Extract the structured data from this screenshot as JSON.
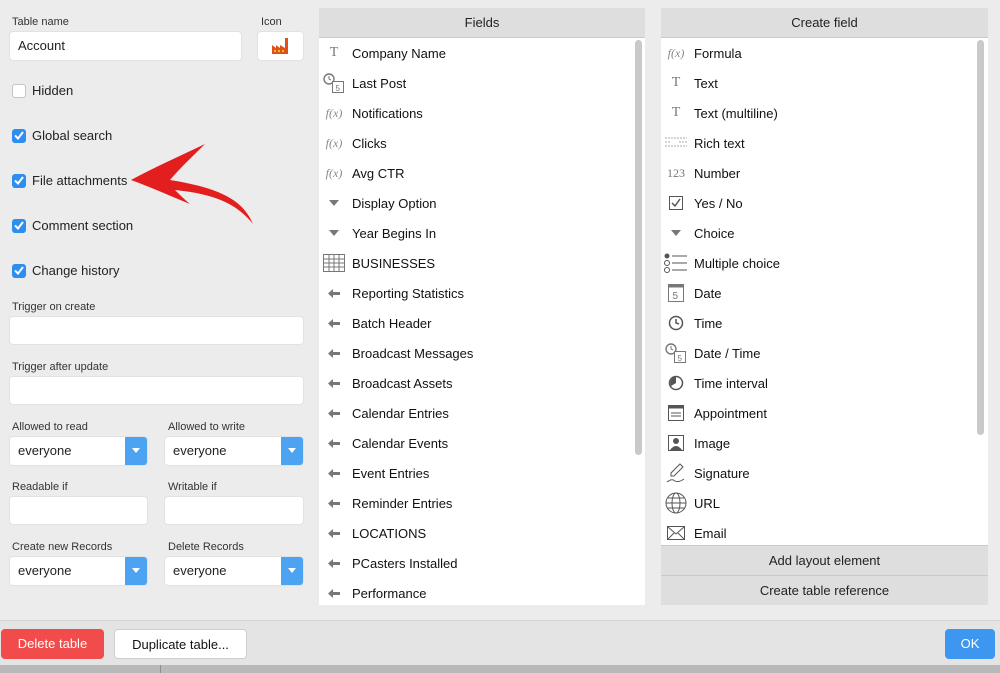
{
  "left": {
    "table_name_label": "Table name",
    "table_name_value": "Account",
    "icon_label": "Icon",
    "icon_name": "factory-icon",
    "options": [
      {
        "label": "Hidden",
        "checked": false
      },
      {
        "label": "Global search",
        "checked": true
      },
      {
        "label": "File attachments",
        "checked": true
      },
      {
        "label": "Comment section",
        "checked": true
      },
      {
        "label": "Change history",
        "checked": true
      }
    ],
    "trigger_create_label": "Trigger on create",
    "trigger_create_value": "",
    "trigger_update_label": "Trigger after update",
    "trigger_update_value": "",
    "allowed_read_label": "Allowed to read",
    "allowed_read_value": "everyone",
    "allowed_write_label": "Allowed to write",
    "allowed_write_value": "everyone",
    "readable_if_label": "Readable if",
    "readable_if_value": "",
    "writable_if_label": "Writable if",
    "writable_if_value": "",
    "create_records_label": "Create new Records",
    "create_records_value": "everyone",
    "delete_records_label": "Delete Records",
    "delete_records_value": "everyone",
    "annotation_color": "#e31e1e"
  },
  "fields": {
    "title": "Fields",
    "items": [
      {
        "label": "Company Name",
        "icon": "text-icon"
      },
      {
        "label": "Last Post",
        "icon": "datetime-icon"
      },
      {
        "label": "Notifications",
        "icon": "formula-icon"
      },
      {
        "label": "Clicks",
        "icon": "formula-icon"
      },
      {
        "label": "Avg CTR",
        "icon": "formula-icon"
      },
      {
        "label": "Display Option",
        "icon": "choice-icon"
      },
      {
        "label": "Year Begins In",
        "icon": "choice-icon"
      },
      {
        "label": "BUSINESSES",
        "icon": "table-icon"
      },
      {
        "label": "Reporting Statistics",
        "icon": "link-arrow-icon"
      },
      {
        "label": "Batch Header",
        "icon": "link-arrow-icon"
      },
      {
        "label": "Broadcast Messages",
        "icon": "link-arrow-icon"
      },
      {
        "label": "Broadcast Assets",
        "icon": "link-arrow-icon"
      },
      {
        "label": "Calendar Entries",
        "icon": "link-arrow-icon"
      },
      {
        "label": "Calendar Events",
        "icon": "link-arrow-icon"
      },
      {
        "label": "Event Entries",
        "icon": "link-arrow-icon"
      },
      {
        "label": "Reminder Entries",
        "icon": "link-arrow-icon"
      },
      {
        "label": "LOCATIONS",
        "icon": "link-arrow-icon"
      },
      {
        "label": "PCasters Installed",
        "icon": "link-arrow-icon"
      },
      {
        "label": "Performance",
        "icon": "link-arrow-icon"
      }
    ]
  },
  "create": {
    "title": "Create field",
    "items": [
      {
        "label": "Formula",
        "icon": "formula-icon"
      },
      {
        "label": "Text",
        "icon": "text-icon"
      },
      {
        "label": "Text (multiline)",
        "icon": "text-icon"
      },
      {
        "label": "Rich text",
        "icon": "rich-text-icon"
      },
      {
        "label": "Number",
        "icon": "number-icon"
      },
      {
        "label": "Yes / No",
        "icon": "checkbox-icon"
      },
      {
        "label": "Choice",
        "icon": "choice-icon"
      },
      {
        "label": "Multiple choice",
        "icon": "multiple-choice-icon"
      },
      {
        "label": "Date",
        "icon": "date-icon"
      },
      {
        "label": "Time",
        "icon": "clock-icon"
      },
      {
        "label": "Date / Time",
        "icon": "datetime-icon"
      },
      {
        "label": "Time interval",
        "icon": "time-interval-icon"
      },
      {
        "label": "Appointment",
        "icon": "appointment-icon"
      },
      {
        "label": "Image",
        "icon": "image-icon"
      },
      {
        "label": "Signature",
        "icon": "signature-icon"
      },
      {
        "label": "URL",
        "icon": "globe-icon"
      },
      {
        "label": "Email",
        "icon": "envelope-icon"
      }
    ],
    "add_layout_label": "Add layout element",
    "create_reference_label": "Create table reference"
  },
  "footer": {
    "delete_label": "Delete table",
    "duplicate_label": "Duplicate table...",
    "ok_label": "OK",
    "delete_color": "#f24b4b",
    "ok_color": "#3d97f0"
  }
}
